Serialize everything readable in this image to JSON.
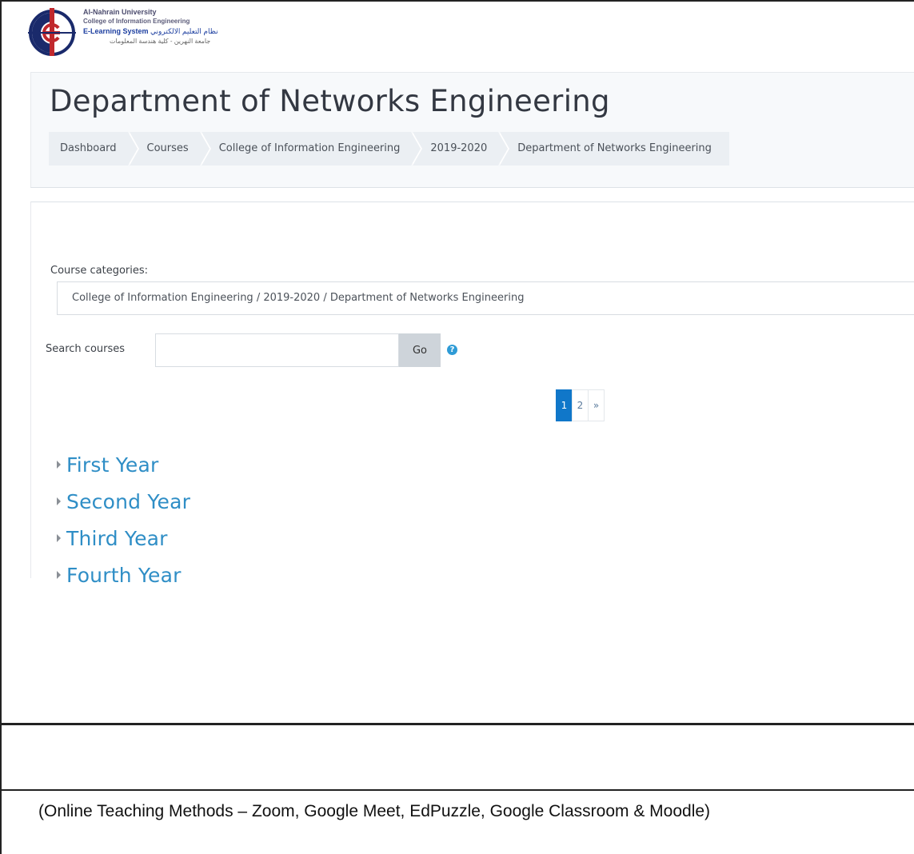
{
  "logo": {
    "line1": "Al-Nahrain University",
    "line2": "College of Information Engineering",
    "line3_en": "E-Learning System",
    "line3_ar": "نظام التعليم الالكتروني",
    "line4_ar": "جامعة النهرين - كلية هندسة المعلومات"
  },
  "header": {
    "title": "Department of Networks Engineering",
    "breadcrumb": [
      "Dashboard",
      "Courses",
      "College of Information Engineering",
      "2019-2020",
      "Department of Networks Engineering"
    ]
  },
  "content": {
    "categories_label": "Course categories:",
    "categories_value": "College of Information Engineering / 2019-2020 / Department of Networks Engineering",
    "search_label": "Search courses",
    "search_value": "",
    "go_label": "Go",
    "help_glyph": "?",
    "pagination": [
      "1",
      "2",
      "»"
    ],
    "active_page": "1",
    "years": [
      "First Year",
      "Second Year",
      "Third Year",
      "Fourth Year"
    ]
  },
  "colors": {
    "accent": "#1077c9",
    "link": "#2f8ec6"
  },
  "caption": "(Online Teaching Methods – Zoom, Google Meet, EdPuzzle, Google Classroom & Moodle)"
}
